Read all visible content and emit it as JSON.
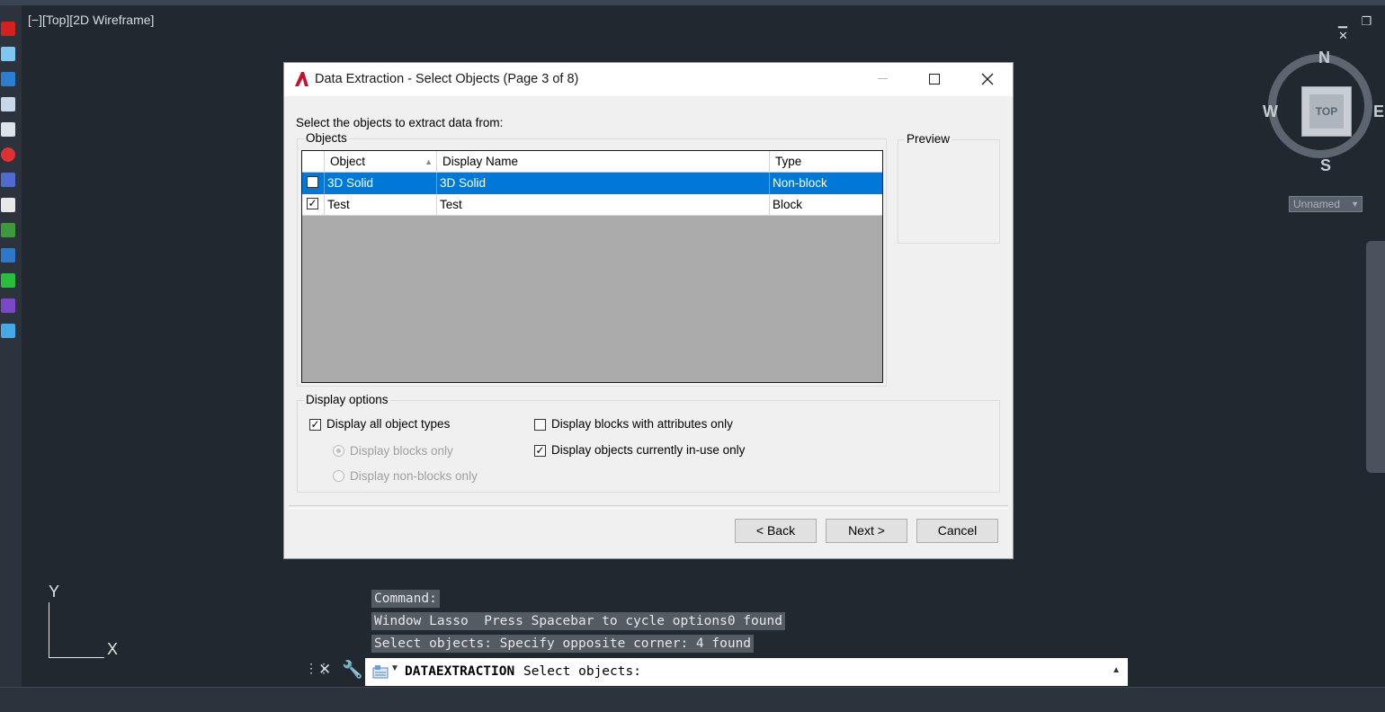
{
  "viewport": {
    "label": "[−][Top][2D Wireframe]",
    "win_controls": "▁ ❐ ✕"
  },
  "viewcube": {
    "face": "TOP",
    "north": "N",
    "south": "S",
    "east": "E",
    "west": "W",
    "ucs_menu": "Unnamed"
  },
  "ucs_icon": {
    "x_label": "X",
    "y_label": "Y"
  },
  "dialog": {
    "title": "Data Extraction - Select Objects (Page 3 of 8)",
    "instruction": "Select the objects to extract data from:",
    "objects_group": "Objects",
    "preview_group": "Preview",
    "columns": {
      "object": "Object",
      "display_name": "Display Name",
      "type": "Type"
    },
    "rows": [
      {
        "checked": false,
        "object": "3D Solid",
        "display_name": "3D Solid",
        "type": "Non-block",
        "selected": true
      },
      {
        "checked": true,
        "object": "Test",
        "display_name": "Test",
        "type": "Block",
        "selected": false
      }
    ],
    "display_options": {
      "title": "Display options",
      "all_types": "Display all object types",
      "blocks_only": "Display blocks only",
      "non_blocks_only": "Display non-blocks only",
      "blocks_with_attrs": "Display blocks with attributes only",
      "in_use_only": "Display objects currently in-use only"
    },
    "buttons": {
      "back": "< Back",
      "next": "Next >",
      "cancel": "Cancel"
    }
  },
  "command": {
    "history": [
      "Command:",
      "Window Lasso  Press Spacebar to cycle options0 found",
      "Select objects: Specify opposite corner: 4 found"
    ],
    "active_command": "DATAEXTRACTION",
    "prompt": "Select objects:"
  },
  "colors": {
    "selection": "#0078d7",
    "background": "#212830"
  }
}
